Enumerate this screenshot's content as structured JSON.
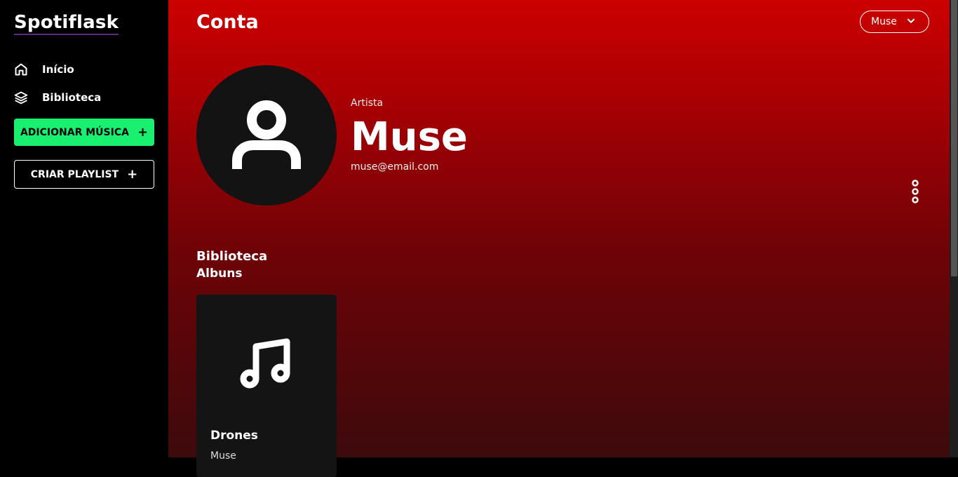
{
  "app": {
    "logo": "Spotiflask"
  },
  "sidebar": {
    "items": [
      {
        "label": "Início",
        "icon": "home-icon"
      },
      {
        "label": "Biblioteca",
        "icon": "layers-icon"
      }
    ],
    "add_music_label": "ADICIONAR MÚSICA",
    "create_playlist_label": "CRIAR PLAYLIST"
  },
  "header": {
    "title": "Conta",
    "user_menu_label": "Muse"
  },
  "profile": {
    "role": "Artista",
    "name": "Muse",
    "email": "muse@email.com"
  },
  "library": {
    "title": "Biblioteca",
    "subtitle": "Albuns",
    "albums": [
      {
        "title": "Drones",
        "artist": "Muse"
      }
    ]
  },
  "colors": {
    "accent": "#1af070",
    "gradient_top": "#cc0000",
    "gradient_bottom": "#3d0a0c",
    "card": "#141414"
  }
}
